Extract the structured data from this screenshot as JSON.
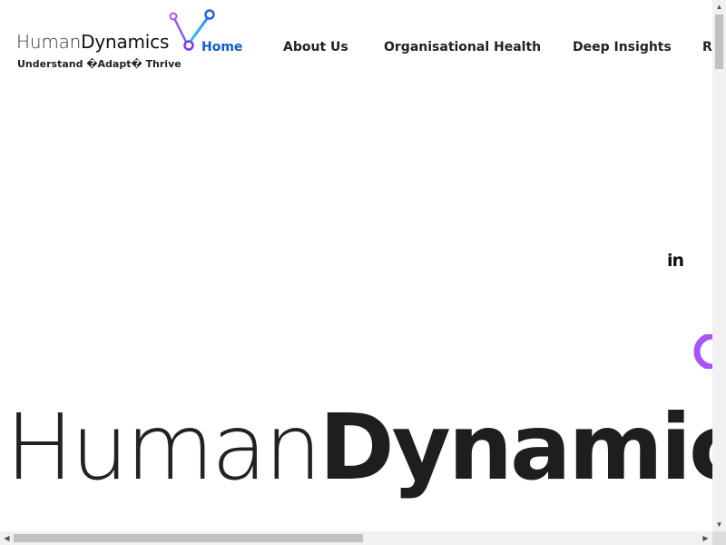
{
  "brand": {
    "name_light": "Human",
    "name_bold": "Dynamics",
    "tagline": "Understand �Adapt� Thrive",
    "logo_icon": "molecule-icon",
    "accent_purple": "#8b5cf6",
    "accent_blue": "#0ea5e9"
  },
  "nav": {
    "items": [
      {
        "label": "Home",
        "active": true
      },
      {
        "label": "About Us",
        "active": false
      },
      {
        "label": "Organisational Health",
        "active": false
      },
      {
        "label": "Deep Insights",
        "active": false
      },
      {
        "label": "Re",
        "active": false
      }
    ],
    "active_color": "#0b5bd3"
  },
  "social": {
    "linkedin_label": "in",
    "linkedin_icon": "linkedin-icon"
  },
  "hero": {
    "title_light": "Human",
    "title_bold": "Dynamics"
  },
  "decor": {
    "ring_color": "#a855f7"
  }
}
